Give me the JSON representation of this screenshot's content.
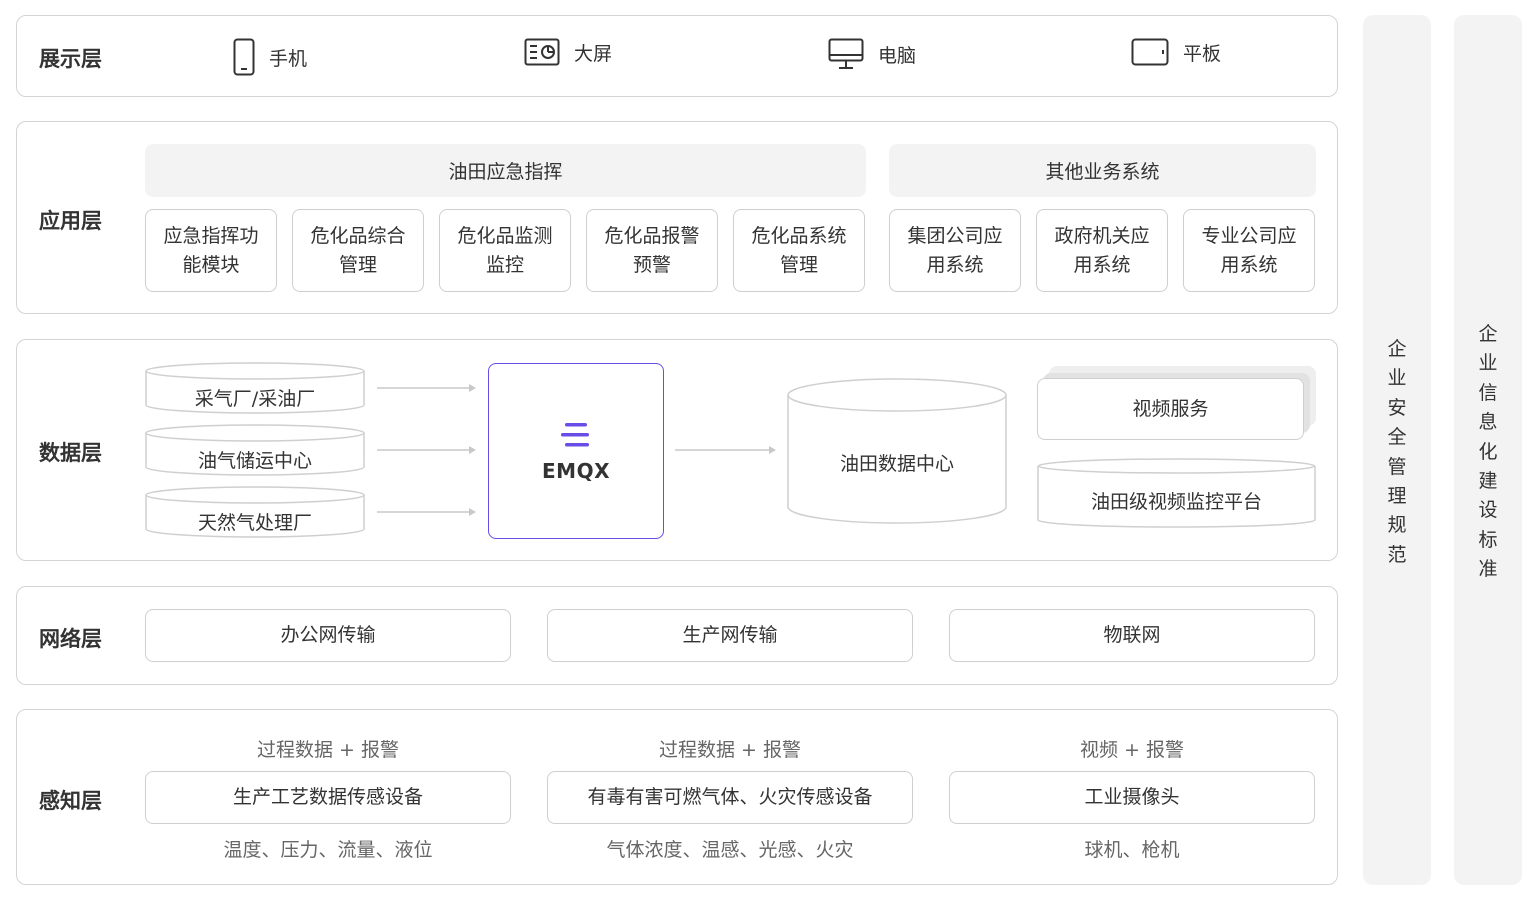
{
  "presentation_layer": {
    "title": "展示层",
    "devices": [
      {
        "label": "手机",
        "icon": "phone-icon"
      },
      {
        "label": "大屏",
        "icon": "big-screen-icon"
      },
      {
        "label": "电脑",
        "icon": "computer-icon"
      },
      {
        "label": "平板",
        "icon": "tablet-icon"
      }
    ]
  },
  "application_layer": {
    "title": "应用层",
    "groups": [
      {
        "title": "油田应急指挥",
        "items": [
          "应急指挥功能模块",
          "危化品综合管理",
          "危化品监测监控",
          "危化品报警预警",
          "危化品系统管理"
        ]
      },
      {
        "title": "其他业务系统",
        "items": [
          "集团公司应用系统",
          "政府机关应用系统",
          "专业公司应用系统"
        ]
      }
    ]
  },
  "data_layer": {
    "title": "数据层",
    "sources": [
      "采气厂/采油厂",
      "油气储运中心",
      "天然气处理厂"
    ],
    "broker": "EMQX",
    "data_center": "油田数据中心",
    "video_service": "视频服务",
    "video_platform": "油田级视频监控平台"
  },
  "network_layer": {
    "title": "网络层",
    "items": [
      "办公网传输",
      "生产网传输",
      "物联网"
    ]
  },
  "perception_layer": {
    "title": "感知层",
    "columns": [
      {
        "top": "过程数据 + 报警",
        "device": "生产工艺数据传感设备",
        "bottom": "温度、压力、流量、液位"
      },
      {
        "top": "过程数据 + 报警",
        "device": "有毒有害可燃气体、火灾传感设备",
        "bottom": "气体浓度、温感、光感、火灾"
      },
      {
        "top": "视频 + 报警",
        "device": "工业摄像头",
        "bottom": "球机、枪机"
      }
    ]
  },
  "side_bars": [
    "企业安全管理规范",
    "企业信息化建设标准"
  ],
  "colors": {
    "accent": "#6a4ce6",
    "border": "#d4d4d4",
    "panel": "#f3f3f3"
  }
}
